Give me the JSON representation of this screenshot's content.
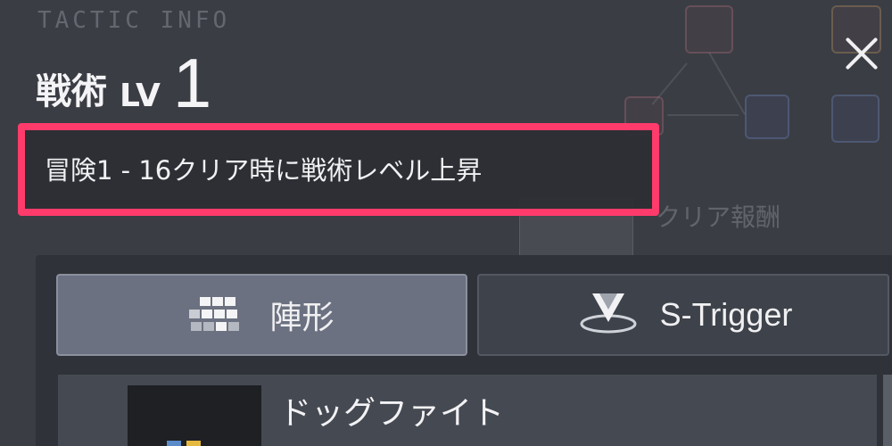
{
  "header": {
    "section_label": "TACTIC INFO",
    "title": "戦術",
    "level_prefix": "LV",
    "level_value": "1",
    "close_icon": "close-icon"
  },
  "condition": {
    "text": "冒険1 - 16クリア時に戦術レベル上昇",
    "highlight_color": "#ff3b6b"
  },
  "background": {
    "reward_label": "クリア報酬"
  },
  "tabs": [
    {
      "label": "陣形",
      "icon": "formation-icon",
      "selected": true
    },
    {
      "label": "S-Trigger",
      "icon": "s-trigger-icon",
      "selected": false
    }
  ],
  "list": {
    "items": [
      {
        "title": "ドッグファイト"
      }
    ]
  }
}
